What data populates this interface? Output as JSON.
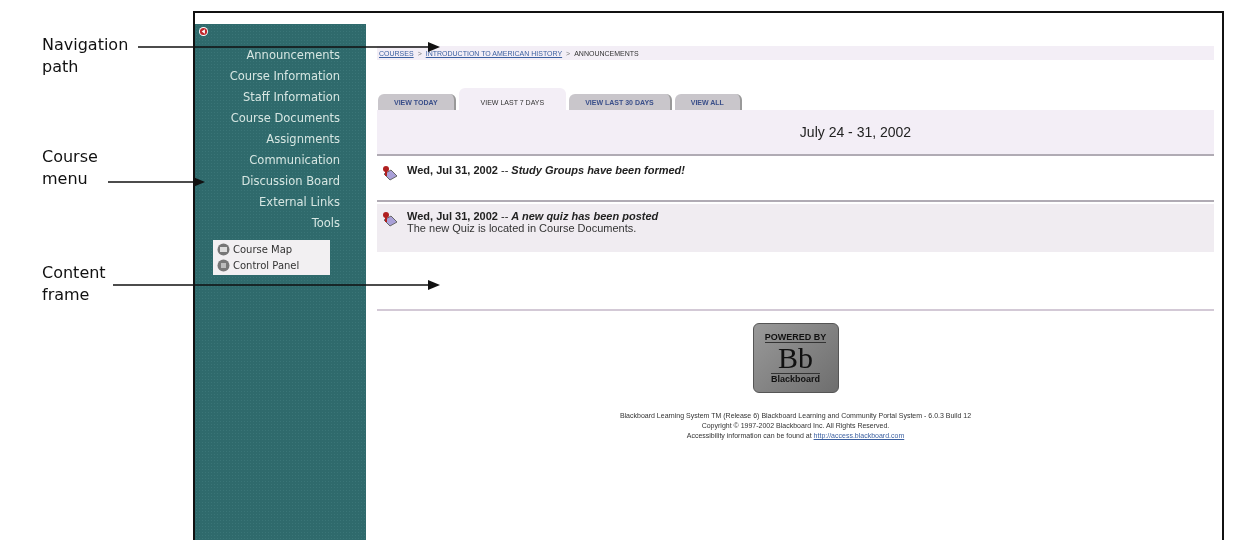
{
  "annotations": [
    {
      "label": "Navigation path"
    },
    {
      "label": "Course menu"
    },
    {
      "label": "Content frame"
    }
  ],
  "breadcrumbs": [
    {
      "text": "COURSES",
      "link": true
    },
    {
      "text": "INTRODUCTION TO AMERICAN HISTORY",
      "link": true
    },
    {
      "text": "ANNOUNCEMENTS",
      "link": false
    }
  ],
  "breadcrumb_separator": ">",
  "course_menu": [
    "Announcements",
    "Course Information",
    "Staff Information",
    "Course Documents",
    "Assignments",
    "Communication",
    "Discussion Board",
    "External Links",
    "Tools"
  ],
  "tools": [
    {
      "label": "Course Map",
      "kind": "map"
    },
    {
      "label": "Control Panel",
      "kind": "panel"
    }
  ],
  "tabs": [
    {
      "label": "VIEW TODAY",
      "selected": false
    },
    {
      "label": "VIEW LAST 7 DAYS",
      "selected": true
    },
    {
      "label": "VIEW LAST 30 DAYS",
      "selected": false
    },
    {
      "label": "VIEW ALL",
      "selected": false
    }
  ],
  "date_range": "July 24 - 31, 2002",
  "announcements": [
    {
      "date": "Wed, Jul 31, 2002",
      "separator": "--",
      "title": "Study Groups have been formed!"
    },
    {
      "date": "Wed, Jul 31, 2002",
      "separator": "--",
      "title": "A new quiz has been posted",
      "body": "The new Quiz is located in Course Documents."
    }
  ],
  "logo": {
    "top": "POWERED BY",
    "main": "Bb",
    "bottom": "Blackboard"
  },
  "footer": {
    "line_1": "Blackboard Learning System TM (Release 6) Blackboard Learning and Community Portal System - 6.0.3 Build 12",
    "line_2": "Copyright © 1997-2002 Blackboard Inc. All Rights Reserved.",
    "line_3": "Accessibility information can be found at",
    "link": "http://access.blackboard.com"
  }
}
